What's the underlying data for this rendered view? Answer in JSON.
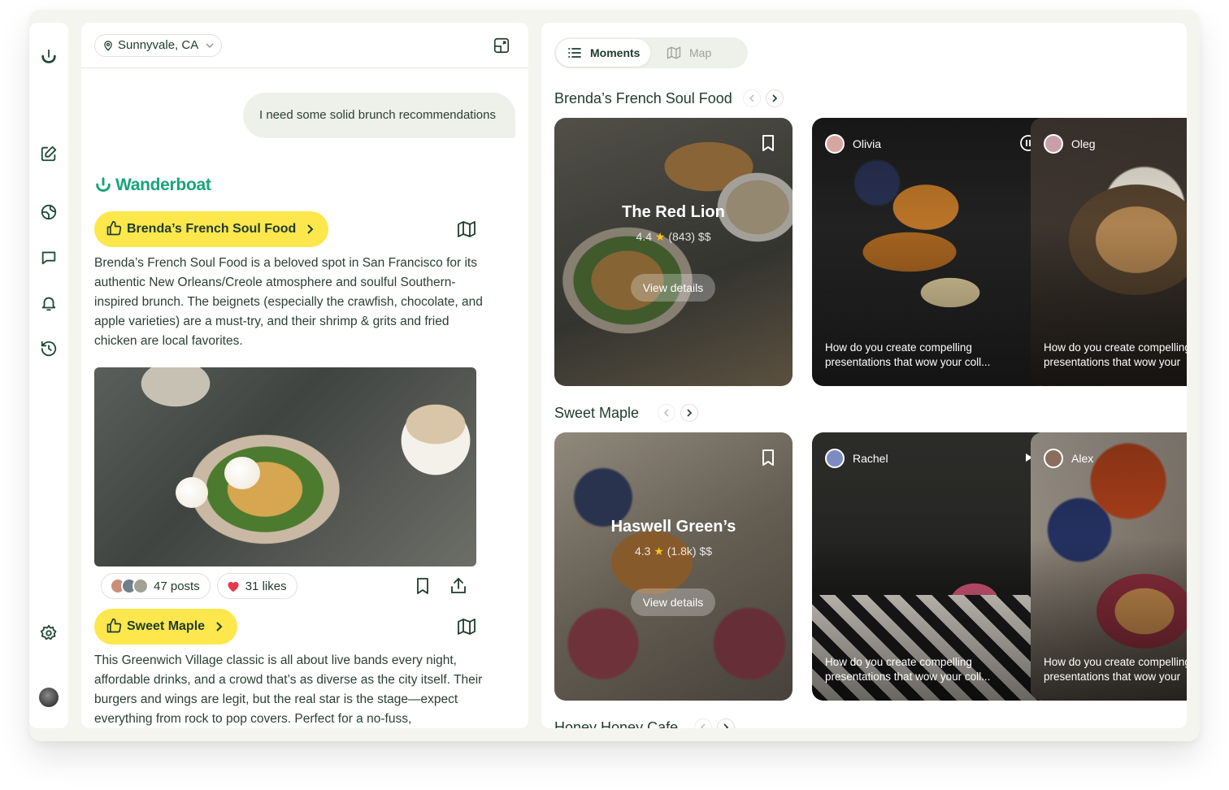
{
  "app": {
    "brand_name": "Wanderboat",
    "accent": "#17a478",
    "highlight": "#fde74c"
  },
  "rail": {
    "icons": [
      "logo-icon",
      "new-chat-icon",
      "explore-icon",
      "chat-icon",
      "bell-icon",
      "history-icon",
      "settings-icon",
      "avatar"
    ]
  },
  "chat": {
    "location": "Sunnyvale, CA",
    "user_message": "I need some solid brunch recommendations",
    "brand": "Wanderboat",
    "recommendations": [
      {
        "name": "Brenda’s French Soul Food",
        "description": "Brenda’s French Soul Food is a beloved spot in San Francisco for its authentic New Orleans/Creole atmosphere and soulful Southern-inspired brunch. The beignets (especially the crawfish, chocolate, and apple varieties) are a must-try, and their shrimp & grits and fried chicken are local favorites.",
        "posts": "47 posts",
        "likes": "31 likes"
      },
      {
        "name": "Sweet Maple",
        "description": "This Greenwich Village classic is all about live bands every night, affordable drinks, and a crowd that’s as diverse as the city itself. Their burgers and wings are legit, but the real star is the stage—expect everything from rock to pop covers. Perfect for a no-fuss,"
      }
    ]
  },
  "moments": {
    "tabs": [
      {
        "label": "Moments",
        "active": true
      },
      {
        "label": "Map",
        "active": false
      }
    ],
    "sections": [
      {
        "title": "Brenda’s French Soul Food",
        "restaurant_card": {
          "name": "The Red Lion",
          "rating": "4.4",
          "reviews": "(843)",
          "price": "$$",
          "button": "View details"
        },
        "posts": [
          {
            "user": "Olivia",
            "caption_line1": "How do you create compelling",
            "caption_line2": "presentations that wow your coll...",
            "control": "pause"
          },
          {
            "user": "Oleg",
            "caption_line1": "How do you create compelling",
            "caption_line2": "presentations that wow your",
            "control": "none"
          }
        ]
      },
      {
        "title": "Sweet Maple",
        "restaurant_card": {
          "name": "Haswell Green’s",
          "rating": "4.3",
          "reviews": "(1.8k)",
          "price": "$$",
          "button": "View details"
        },
        "posts": [
          {
            "user": "Rachel",
            "caption_line1": "How do you create compelling",
            "caption_line2": "presentations that wow your coll...",
            "control": "play"
          },
          {
            "user": "Alex",
            "caption_line1": "How do you create compelling",
            "caption_line2": "presentations that wow your",
            "control": "none"
          }
        ]
      },
      {
        "title": "Honey Honey Cafe"
      }
    ]
  }
}
